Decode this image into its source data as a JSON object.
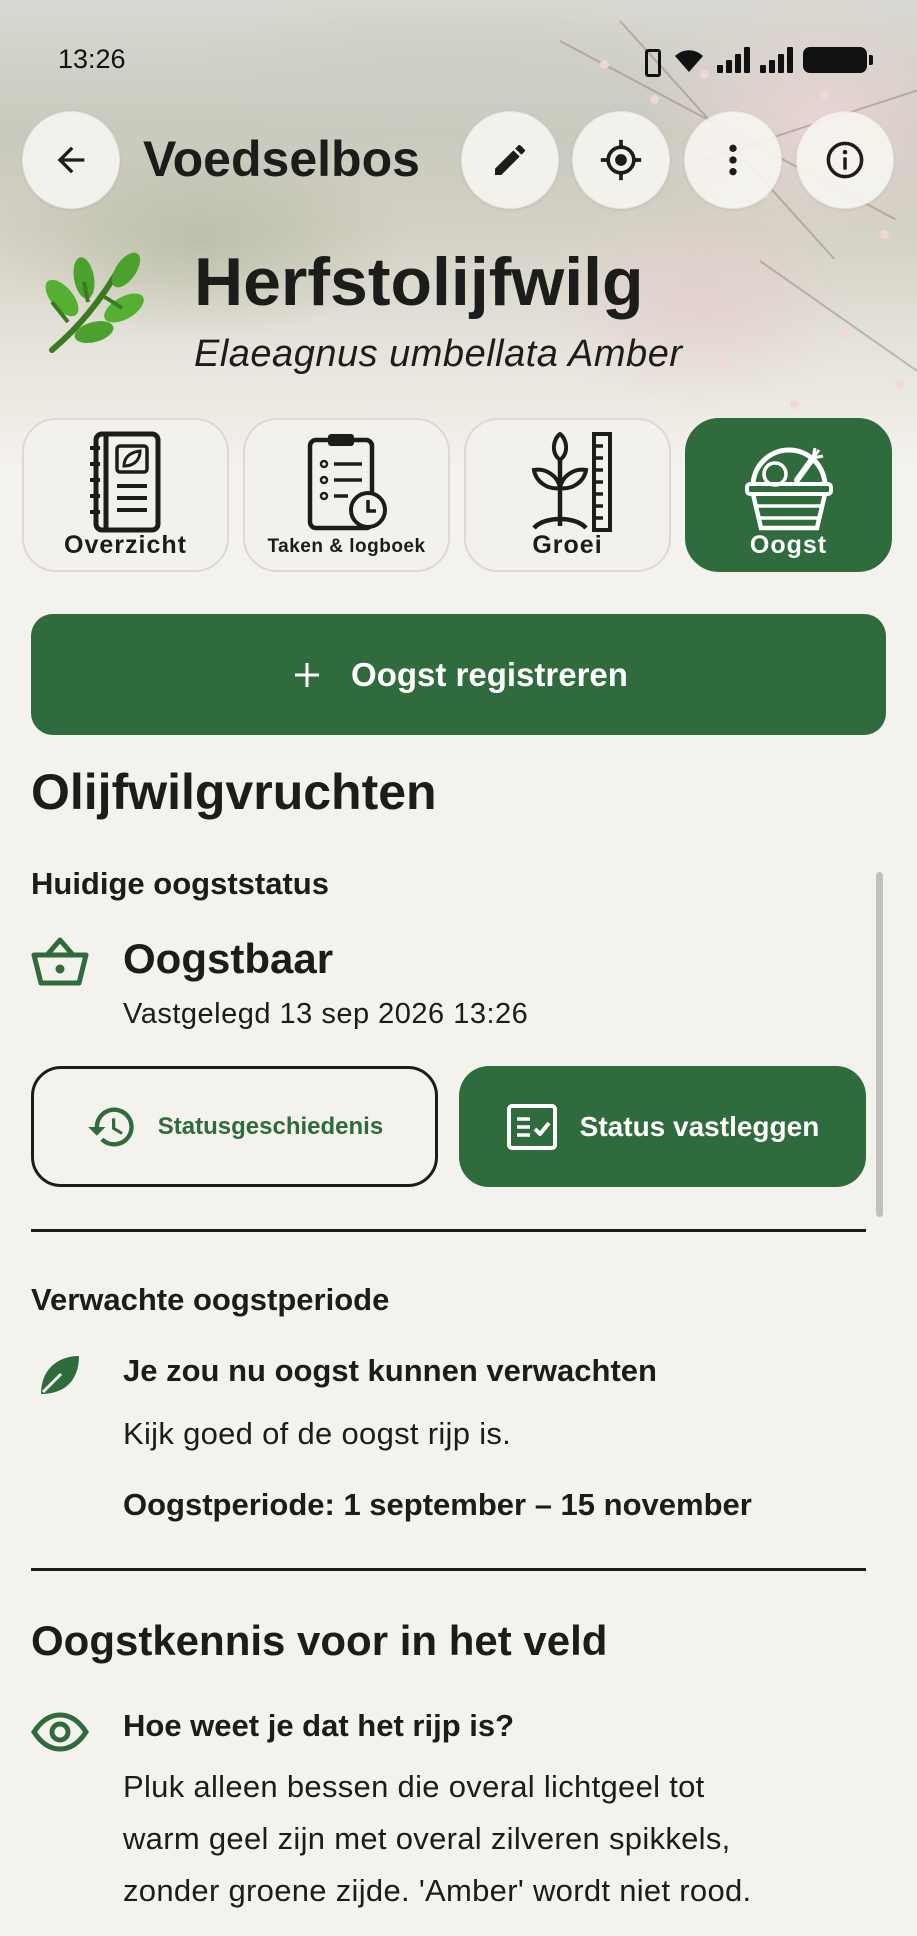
{
  "status_bar": {
    "time": "13:26"
  },
  "app_bar": {
    "title": "Voedselbos"
  },
  "plant": {
    "name": "Herfstolijfwilg",
    "latin": "Elaeagnus umbellata Amber"
  },
  "tabs": [
    {
      "label": "Overzicht",
      "icon": "notebook-icon",
      "active": false
    },
    {
      "label": "Taken & logboek",
      "icon": "checklist-clock-icon",
      "active": false
    },
    {
      "label": "Groei",
      "icon": "seedling-ruler-icon",
      "active": false
    },
    {
      "label": "Oogst",
      "icon": "harvest-basket-icon",
      "active": true
    }
  ],
  "actions": {
    "register_harvest": "Oogst registreren"
  },
  "crop": {
    "title": "Olijfwilgvruchten",
    "current_status_heading": "Huidige oogststatus",
    "status": "Oogstbaar",
    "status_recorded": "Vastgelegd 13 sep 2026 13:26",
    "history_button": "Statusgeschiedenis",
    "record_button": "Status vastleggen"
  },
  "expected": {
    "heading": "Verwachte oogstperiode",
    "title": "Je zou nu oogst kunnen verwachten",
    "text": "Kijk goed of de oogst rijp is.",
    "period": "Oogstperiode: 1 september – 15 november"
  },
  "knowledge": {
    "heading": "Oogstkennis voor in het veld",
    "item_title": "Hoe weet je dat het rijp is?",
    "item_lines": [
      "Pluk alleen bessen die overal lichtgeel tot",
      "warm geel zijn met overal zilveren spikkels,",
      "zonder groene zijde. 'Amber' wordt niet rood."
    ]
  },
  "colors": {
    "accent": "#2f6b3c",
    "background": "#f4f2ed",
    "text": "#1c1c1a"
  }
}
